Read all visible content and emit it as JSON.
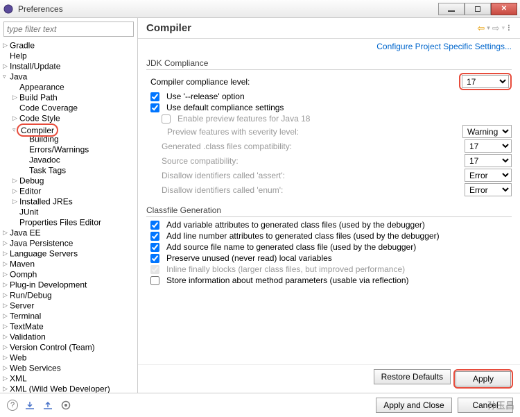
{
  "window_title": "Preferences",
  "filter_placeholder": "type filter text",
  "tree": [
    {
      "t": ">",
      "l": "Gradle"
    },
    {
      "t": "",
      "l": "Help"
    },
    {
      "t": ">",
      "l": "Install/Update"
    },
    {
      "t": "v",
      "l": "Java",
      "children": [
        {
          "t": "",
          "l": "Appearance"
        },
        {
          "t": ">",
          "l": "Build Path"
        },
        {
          "t": "",
          "l": "Code Coverage"
        },
        {
          "t": ">",
          "l": "Code Style"
        },
        {
          "t": "v",
          "l": "Compiler",
          "hl": true,
          "children": [
            {
              "t": "",
              "l": "Building"
            },
            {
              "t": "",
              "l": "Errors/Warnings"
            },
            {
              "t": "",
              "l": "Javadoc"
            },
            {
              "t": "",
              "l": "Task Tags"
            }
          ]
        },
        {
          "t": ">",
          "l": "Debug"
        },
        {
          "t": ">",
          "l": "Editor"
        },
        {
          "t": ">",
          "l": "Installed JREs"
        },
        {
          "t": "",
          "l": "JUnit"
        },
        {
          "t": "",
          "l": "Properties Files Editor"
        }
      ]
    },
    {
      "t": ">",
      "l": "Java EE"
    },
    {
      "t": ">",
      "l": "Java Persistence"
    },
    {
      "t": ">",
      "l": "Language Servers"
    },
    {
      "t": ">",
      "l": "Maven"
    },
    {
      "t": ">",
      "l": "Oomph"
    },
    {
      "t": ">",
      "l": "Plug-in Development"
    },
    {
      "t": ">",
      "l": "Run/Debug"
    },
    {
      "t": ">",
      "l": "Server"
    },
    {
      "t": ">",
      "l": "Terminal"
    },
    {
      "t": ">",
      "l": "TextMate"
    },
    {
      "t": ">",
      "l": "Validation"
    },
    {
      "t": ">",
      "l": "Version Control (Team)"
    },
    {
      "t": ">",
      "l": "Web"
    },
    {
      "t": ">",
      "l": "Web Services"
    },
    {
      "t": ">",
      "l": "XML"
    },
    {
      "t": ">",
      "l": "XML (Wild Web Developer)"
    }
  ],
  "page_title": "Compiler",
  "config_link": "Configure Project Specific Settings...",
  "sections": {
    "jdk_compliance": {
      "title": "JDK Compliance",
      "compliance_level_label": "Compiler compliance level:",
      "compliance_level_value": "17",
      "use_release": {
        "label": "Use '--release' option",
        "checked": true
      },
      "use_default": {
        "label": "Use default compliance settings",
        "checked": true
      },
      "enable_preview": {
        "label": "Enable preview features for Java 18",
        "checked": false
      },
      "preview_severity": {
        "label": "Preview features with severity level:",
        "value": "Warning"
      },
      "gen_class": {
        "label": "Generated .class files compatibility:",
        "value": "17"
      },
      "source_compat": {
        "label": "Source compatibility:",
        "value": "17"
      },
      "disallow_assert": {
        "label": "Disallow identifiers called 'assert':",
        "value": "Error"
      },
      "disallow_enum": {
        "label": "Disallow identifiers called 'enum':",
        "value": "Error"
      }
    },
    "classfile_gen": {
      "title": "Classfile Generation",
      "opts": [
        {
          "label": "Add variable attributes to generated class files (used by the debugger)",
          "checked": true
        },
        {
          "label": "Add line number attributes to generated class files (used by the debugger)",
          "checked": true
        },
        {
          "label": "Add source file name to generated class file (used by the debugger)",
          "checked": true
        },
        {
          "label": "Preserve unused (never read) local variables",
          "checked": true
        },
        {
          "label": "Inline finally blocks (larger class files, but improved performance)",
          "checked": true,
          "disabled": true
        },
        {
          "label": "Store information about method parameters (usable via reflection)",
          "checked": false
        }
      ]
    }
  },
  "buttons": {
    "restore": "Restore Defaults",
    "apply": "Apply",
    "apply_close": "Apply and Close",
    "cancel": "Cancel"
  },
  "watermark": "孙玉昌"
}
